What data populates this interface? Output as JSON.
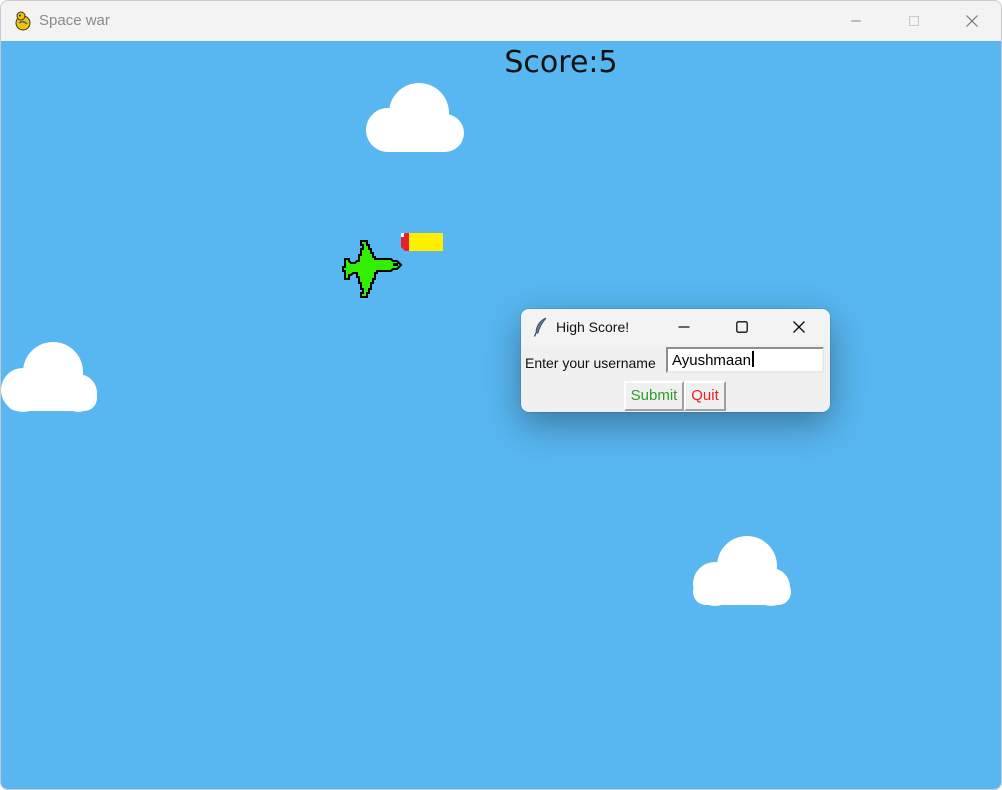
{
  "window": {
    "title": "Space war",
    "app_icon": "pygame-snake-icon"
  },
  "game": {
    "score_text": "Score:5",
    "background_color": "#58b6f0",
    "player_color": "#33ee00",
    "bullet_color": "#ffee00"
  },
  "dialog": {
    "title": "High Score!",
    "icon": "feather-icon",
    "prompt_label": "Enter your username",
    "username_value": "Ayushmaan",
    "submit_label": "Submit",
    "quit_label": "Quit",
    "submit_color": "#2a9d2a",
    "quit_color": "#e52020"
  }
}
